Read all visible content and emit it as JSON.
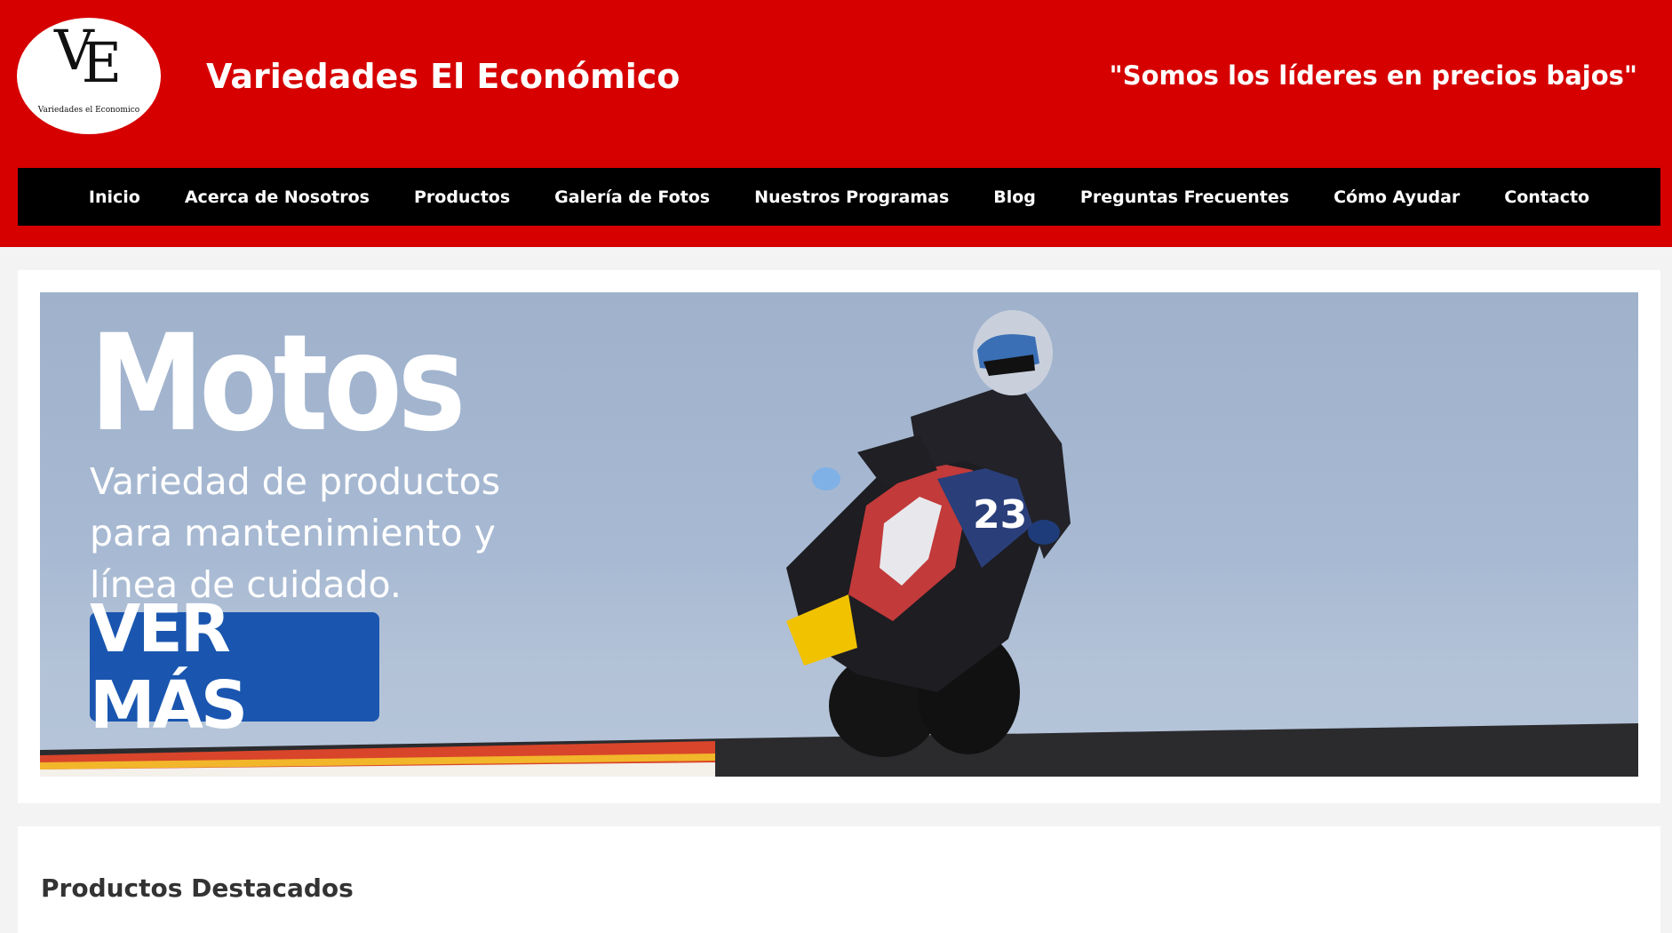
{
  "header": {
    "logo_text": "VE",
    "logo_subtext": "Variedades el Economico",
    "site_title": "Variedades El Económico",
    "tagline": "\"Somos los líderes en precios bajos\"",
    "background_color": "#d60000"
  },
  "nav": {
    "items": [
      {
        "label": "Inicio"
      },
      {
        "label": "Acerca de Nosotros"
      },
      {
        "label": "Productos"
      },
      {
        "label": "Galería de Fotos"
      },
      {
        "label": "Nuestros Programas"
      },
      {
        "label": "Blog"
      },
      {
        "label": "Preguntas Frecuentes"
      },
      {
        "label": "Cómo Ayudar"
      },
      {
        "label": "Contacto"
      }
    ]
  },
  "banner": {
    "title": "Motos",
    "subtitle": "Variedad de productos para mantenimiento y línea de cuidado.",
    "button_label": "VER MÁS",
    "button_color": "#1a56b0",
    "image_description_icon": "motorcycle-rider-image"
  },
  "featured": {
    "title": "Productos Destacados"
  }
}
